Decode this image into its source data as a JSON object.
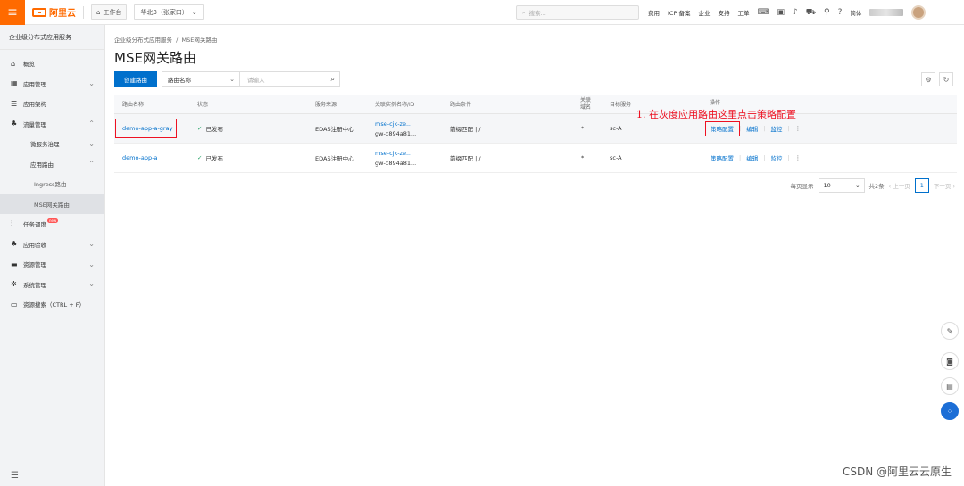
{
  "topbar": {
    "logo_text": "阿里云",
    "workbench": "工作台",
    "region": "华北3（张家口）",
    "search_placeholder": "搜索...",
    "nav": [
      "费用",
      "ICP 备案",
      "企业",
      "支持",
      "工单"
    ],
    "lang": "简体"
  },
  "sidebar": {
    "title": "企业级分布式应用服务",
    "items": [
      {
        "label": "概览",
        "icon": "home-icon"
      },
      {
        "label": "应用管理",
        "icon": "grid-icon"
      },
      {
        "label": "应用架构",
        "icon": "architecture-icon"
      },
      {
        "label": "流量管理",
        "icon": "traffic-icon"
      },
      {
        "label": "微服务治理"
      },
      {
        "label": "应用路由"
      },
      {
        "label": "Ingress路由"
      },
      {
        "label": "MSE网关路由"
      },
      {
        "label": "任务调度",
        "badge": "new",
        "icon": "schedule-icon"
      },
      {
        "label": "应用验收",
        "icon": "check-icon"
      },
      {
        "label": "资源管理",
        "icon": "folder-icon"
      },
      {
        "label": "系统管理",
        "icon": "gear-icon"
      },
      {
        "label": "资源搜索（CTRL + F）",
        "icon": "search-icon"
      }
    ]
  },
  "main": {
    "breadcrumb": [
      "企业级分布式应用服务",
      "MSE网关路由"
    ],
    "title": "MSE网关路由",
    "create_button": "创建路由",
    "filter_select": "路由名称",
    "filter_placeholder": "请输入",
    "columns": [
      "路由名称",
      "状态",
      "服务来源",
      "关联实例名称/ID",
      "路由条件",
      "关联域名",
      "目标服务",
      "操作"
    ],
    "rows": [
      {
        "name": "demo-app-a-gray",
        "status": "已发布",
        "source": "EDAS注册中心",
        "instance_name": "mse-cjk-ze...",
        "instance_id": "gw-c894a81...",
        "condition": "前缀匹配 | /",
        "domain": "*",
        "target": "sc-A",
        "ops": [
          "策略配置",
          "编辑",
          "监控"
        ]
      },
      {
        "name": "demo-app-a",
        "status": "已发布",
        "source": "EDAS注册中心",
        "instance_name": "mse-cjk-ze...",
        "instance_id": "gw-c894a81...",
        "condition": "前缀匹配 | /",
        "domain": "*",
        "target": "sc-A",
        "ops": [
          "策略配置",
          "编辑",
          "监控"
        ]
      }
    ],
    "annotation": "1. 在灰度应用路由这里点击策略配置",
    "pagination": {
      "per_page_label": "每页显示",
      "per_page": "10",
      "total": "共2条",
      "prev": "上一页",
      "current": "1",
      "next": "下一页"
    }
  },
  "watermark": "CSDN @阿里云云原生",
  "colors": {
    "brand": "#ff6a00",
    "primary": "#0070cc",
    "annotation": "#ee1122"
  }
}
